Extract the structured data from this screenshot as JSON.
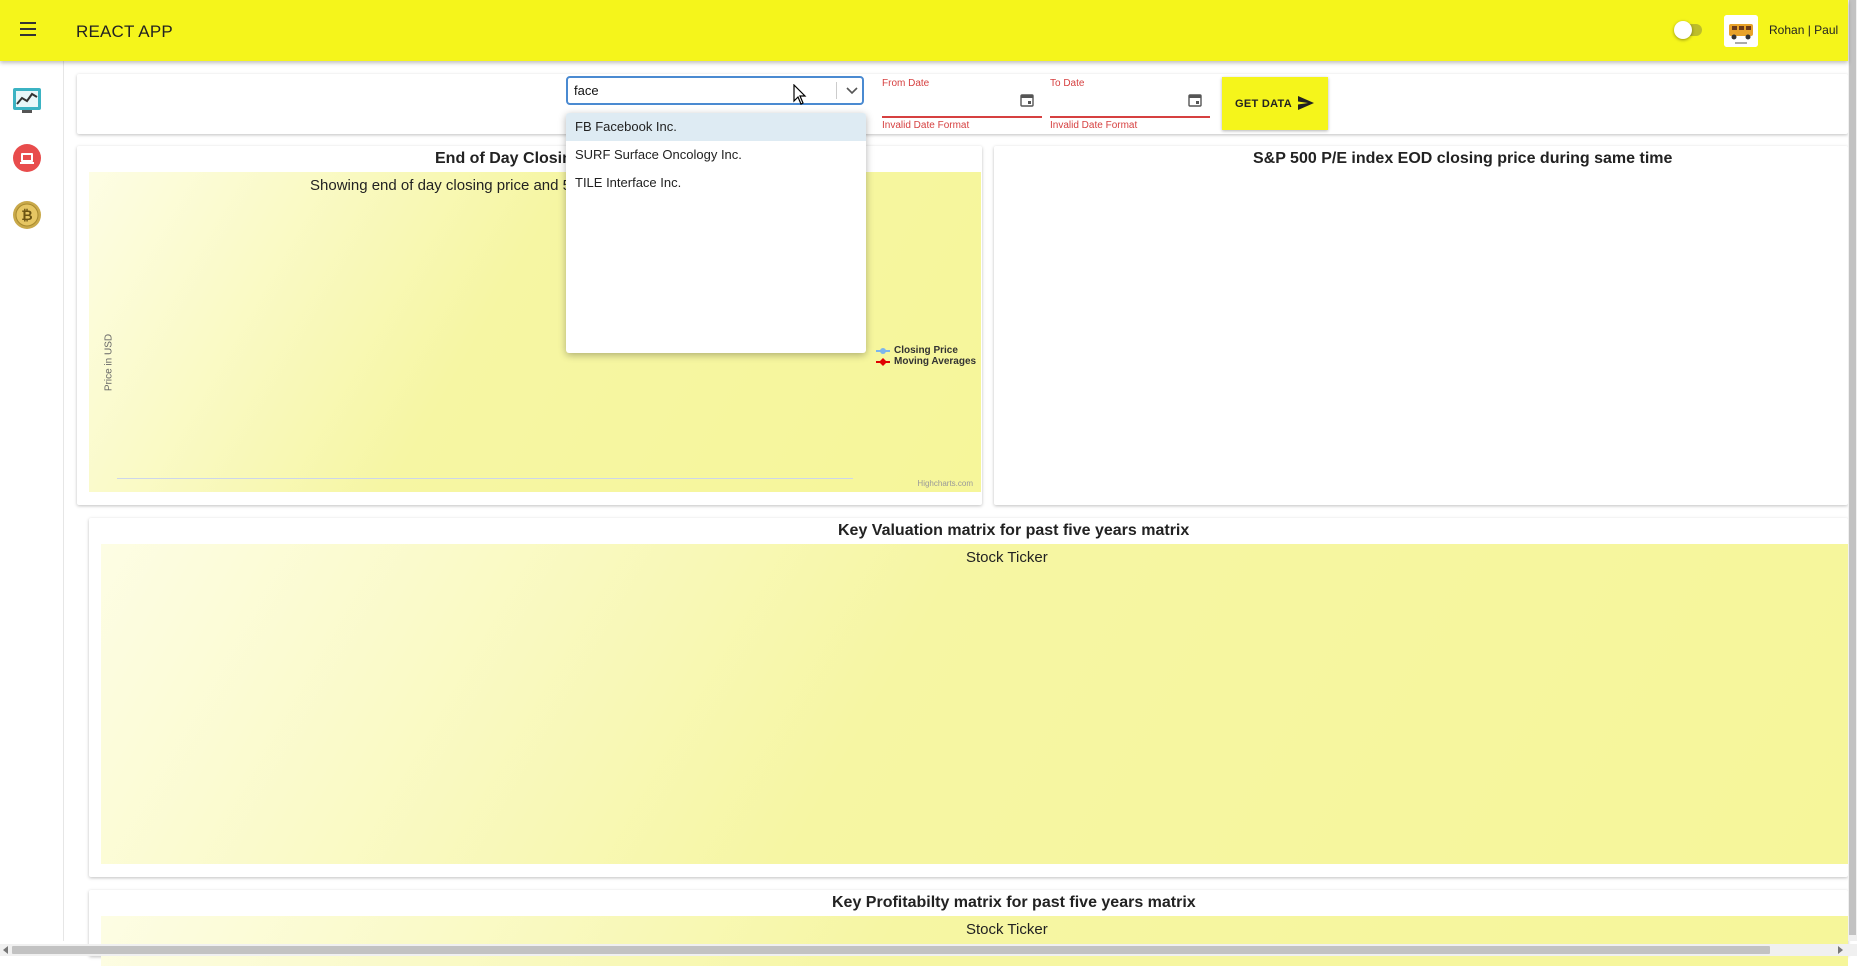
{
  "app": {
    "title": "REACT APP",
    "user_name": "Rohan | Paul"
  },
  "search": {
    "value": "face"
  },
  "suggestions": [
    {
      "label": "FB Facebook Inc.",
      "highlighted": true
    },
    {
      "label": "SURF Surface Oncology Inc.",
      "highlighted": false
    },
    {
      "label": "TILE Interface Inc.",
      "highlighted": false
    }
  ],
  "from_date": {
    "label": "From Date",
    "error": "Invalid Date Format"
  },
  "to_date": {
    "label": "To Date",
    "error": "Invalid Date Format"
  },
  "get_data": {
    "label": "GET DATA"
  },
  "eod_chart": {
    "title": "End of Day Closing",
    "subtitle": "Showing end of day closing price and 5",
    "ylabel": "Price in USD",
    "legend": [
      "Closing Price",
      "Moving Averages"
    ],
    "credit": "Highcharts.com"
  },
  "sp_chart": {
    "title": "S&P 500 P/E index EOD closing price during same time"
  },
  "valuation": {
    "title": "Key Valuation matrix for past five years matrix",
    "subtitle": "Stock Ticker"
  },
  "profitability": {
    "title": "Key Profitabilty matrix for past five years matrix",
    "subtitle": "Stock Ticker"
  },
  "colors": {
    "accent": "#f5f51b",
    "error": "#d64040",
    "focus": "#4a8ad1",
    "closing_series": "#7cb5ec",
    "ma_series": "#e00000"
  }
}
